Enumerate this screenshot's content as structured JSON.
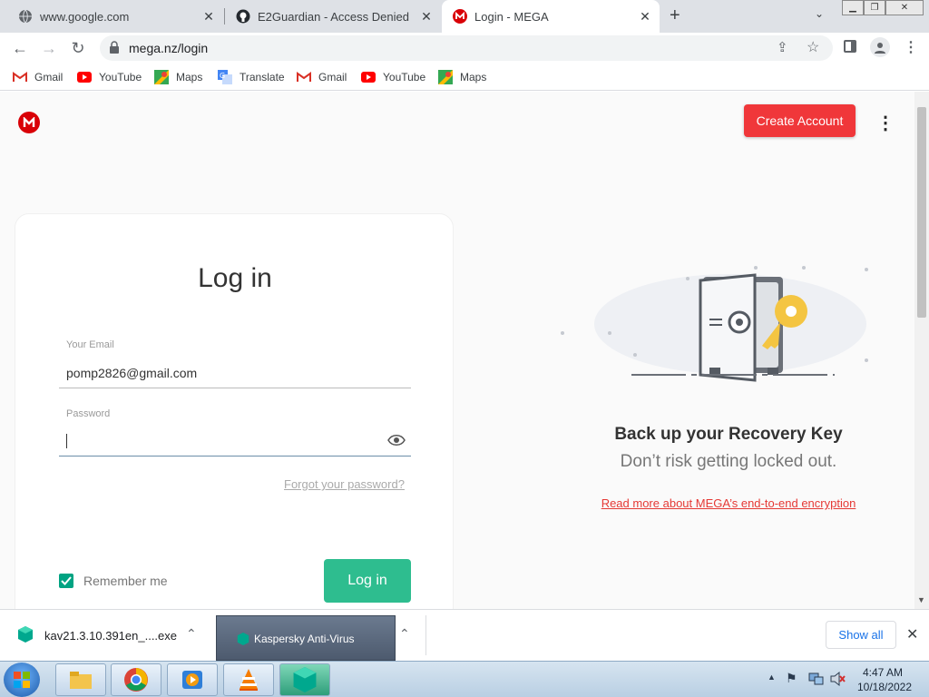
{
  "tabs": [
    {
      "title": "www.google.com",
      "icon": "globe-icon"
    },
    {
      "title": "E2Guardian - Access Denied",
      "icon": "github-icon"
    },
    {
      "title": "Login - MEGA",
      "icon": "mega-icon"
    }
  ],
  "address": {
    "url": "mega.nz/login"
  },
  "bookmarks": [
    {
      "label": "Gmail",
      "icon": "gmail-icon"
    },
    {
      "label": "YouTube",
      "icon": "youtube-icon"
    },
    {
      "label": "Maps",
      "icon": "maps-icon"
    },
    {
      "label": "Translate",
      "icon": "translate-icon"
    },
    {
      "label": "Gmail",
      "icon": "gmail-icon"
    },
    {
      "label": "YouTube",
      "icon": "youtube-icon"
    },
    {
      "label": "Maps",
      "icon": "maps-icon"
    }
  ],
  "header": {
    "create_account": "Create Account"
  },
  "login": {
    "title": "Log in",
    "email_label": "Your Email",
    "email_value": "pomp2826@gmail.com",
    "password_label": "Password",
    "password_value": "",
    "forgot": "Forgot your password?",
    "remember": "Remember me",
    "remember_checked": true,
    "submit": "Log in"
  },
  "promo": {
    "heading": "Back up your Recovery Key",
    "subheading": "Don’t risk getting locked out.",
    "link": "Read more about MEGA’s end-to-end encryption"
  },
  "downloads": {
    "items": [
      {
        "name": "kav21.3.10.391en_....exe"
      },
      {
        "name": "Kaspersky Anti-Virus"
      }
    ],
    "show_all": "Show all"
  },
  "taskbar": {
    "time": "4:47 AM",
    "date": "10/18/2022"
  },
  "colors": {
    "mega_red": "#d90007",
    "create_btn": "#f0373a",
    "login_btn": "#00a382",
    "link_red": "#e53935"
  }
}
